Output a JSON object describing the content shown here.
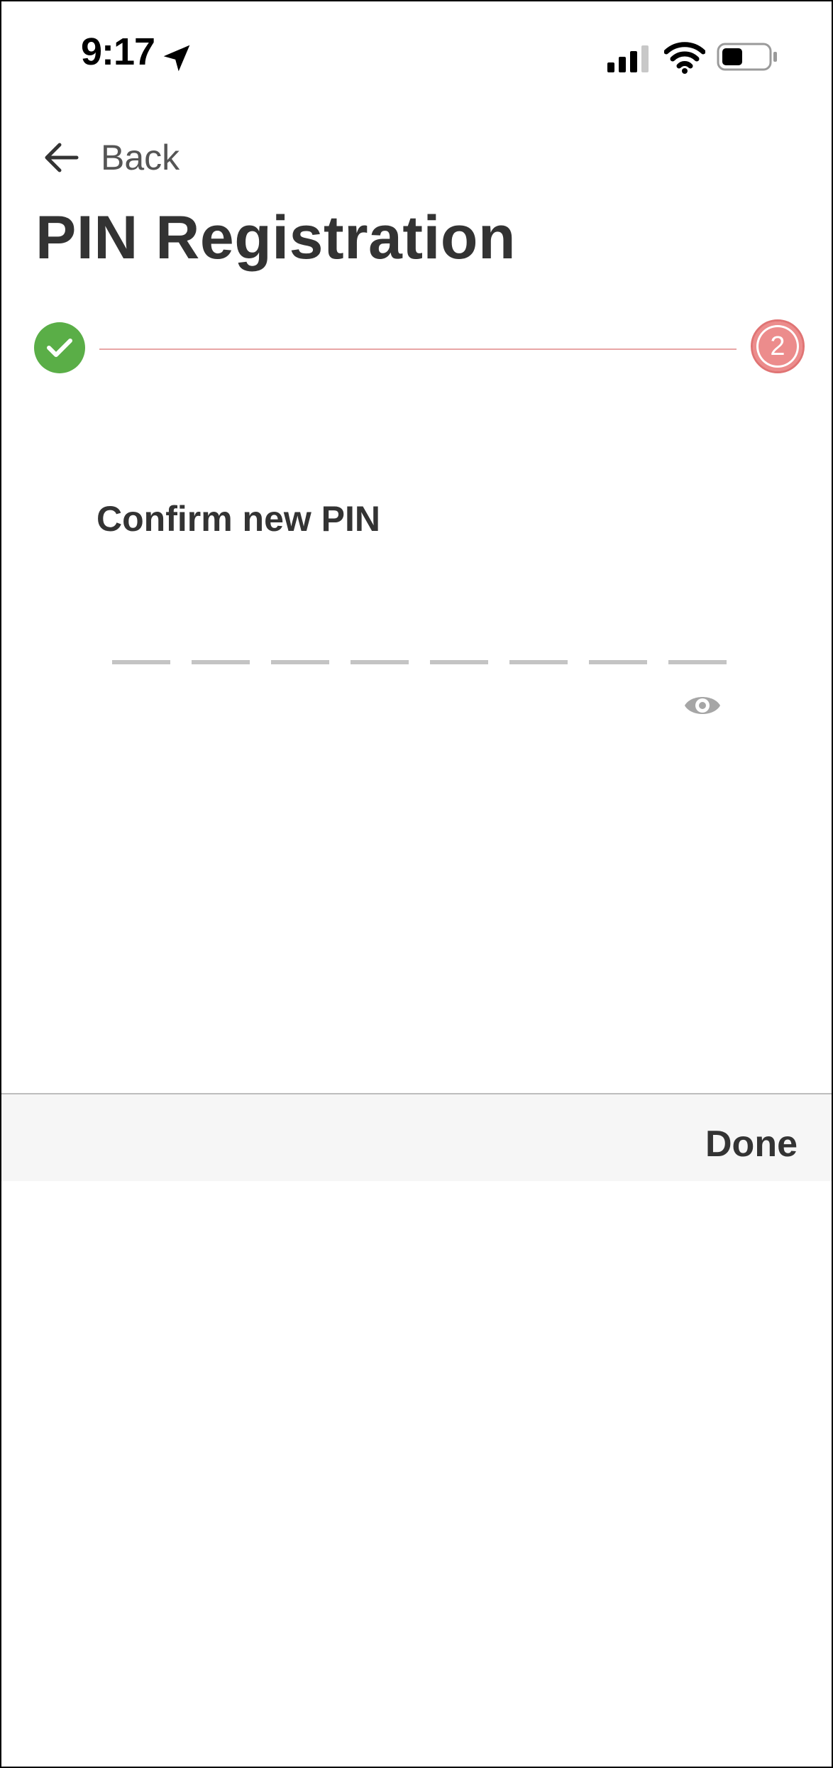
{
  "status_bar": {
    "time": "9:17",
    "icons": [
      "location-arrow-icon",
      "signal-icon",
      "wifi-icon",
      "battery-icon"
    ]
  },
  "nav": {
    "back_label": "Back"
  },
  "page": {
    "title": "PIN Registration"
  },
  "stepper": {
    "step1_state": "completed",
    "step2_number": "2",
    "colors": {
      "completed": "#5aae47",
      "current": "#ec8c8c",
      "line": "#e8a6a6"
    }
  },
  "form": {
    "label": "Confirm new PIN",
    "pin_length": 8,
    "pin_value": "",
    "toggle_icon": "eye-icon"
  },
  "accessory_bar": {
    "done_label": "Done"
  }
}
